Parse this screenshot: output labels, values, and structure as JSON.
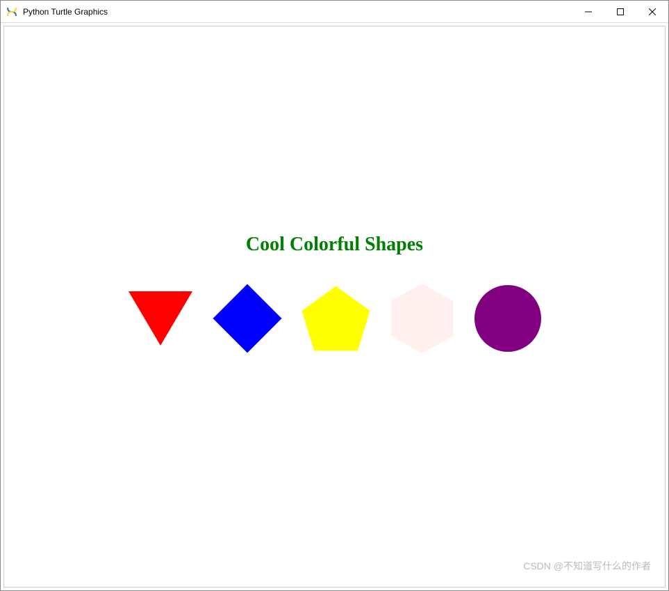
{
  "window": {
    "title": "Python Turtle Graphics",
    "icon": "python-turtle-icon"
  },
  "titlebar": {
    "minimize": "—",
    "maximize": "☐",
    "close": "✕"
  },
  "canvas": {
    "title": "Cool Colorful Shapes"
  },
  "shapes": [
    {
      "name": "triangle",
      "color": "#ff0000"
    },
    {
      "name": "diamond",
      "color": "#0000ff"
    },
    {
      "name": "pentagon",
      "color": "#ffff00"
    },
    {
      "name": "hexagon",
      "color": "#fff0ee"
    },
    {
      "name": "circle",
      "color": "#800080"
    }
  ],
  "watermark": "CSDN @不知道写什么的作者"
}
